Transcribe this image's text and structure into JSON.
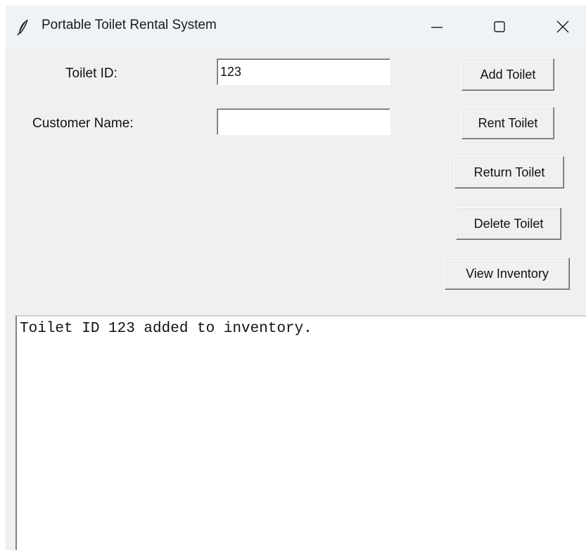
{
  "window": {
    "title": "Portable Toilet Rental System",
    "app_icon": "feather-icon",
    "controls": {
      "minimize_icon": "minimize-icon",
      "maximize_icon": "maximize-icon",
      "close_icon": "close-icon"
    }
  },
  "form": {
    "toilet_id_label": "Toilet ID:",
    "toilet_id_value": "123",
    "customer_name_label": "Customer Name:",
    "customer_name_value": ""
  },
  "buttons": {
    "add": "Add Toilet",
    "rent": "Rent Toilet",
    "return": "Return Toilet",
    "delete": "Delete Toilet",
    "view": "View Inventory"
  },
  "output": {
    "lines": [
      "Toilet ID 123 added to inventory."
    ]
  }
}
